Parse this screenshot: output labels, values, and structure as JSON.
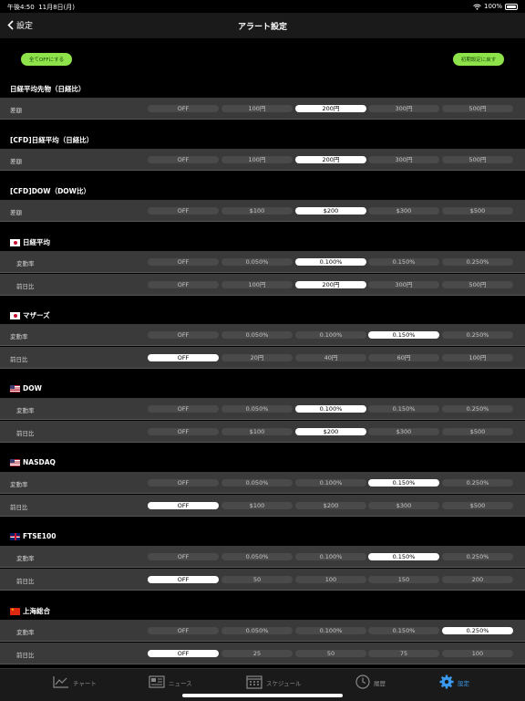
{
  "status": {
    "time": "午後4:50",
    "date": "11月8日(月)",
    "battery": "100%"
  },
  "nav": {
    "back_label": "設定",
    "title": "アラート設定"
  },
  "buttons": {
    "all_off": "全てOFFにする",
    "reset_defaults": "初期設定に戻す"
  },
  "sections": [
    {
      "title": "日経平均先物（日経比）",
      "flag": "none",
      "rows": [
        {
          "label": "差額",
          "options": [
            "OFF",
            "100円",
            "200円",
            "300円",
            "500円"
          ],
          "selected": 2
        }
      ]
    },
    {
      "title": "[CFD]日経平均（日経比）",
      "flag": "none",
      "rows": [
        {
          "label": "差額",
          "options": [
            "OFF",
            "100円",
            "200円",
            "300円",
            "500円"
          ],
          "selected": 2
        }
      ]
    },
    {
      "title": "[CFD]DOW（DOW比）",
      "flag": "none",
      "rows": [
        {
          "label": "差額",
          "options": [
            "OFF",
            "$100",
            "$200",
            "$300",
            "$500"
          ],
          "selected": 2
        }
      ]
    },
    {
      "title": "日経平均",
      "flag": "jp",
      "rows": [
        {
          "label": "変動率",
          "options": [
            "OFF",
            "0.050%",
            "0.100%",
            "0.150%",
            "0.250%"
          ],
          "selected": 2
        },
        {
          "label": "前日比",
          "options": [
            "OFF",
            "100円",
            "200円",
            "300円",
            "500円"
          ],
          "selected": 2
        }
      ]
    },
    {
      "title": "マザーズ",
      "flag": "jp",
      "rows": [
        {
          "label": "変動率",
          "options": [
            "OFF",
            "0.050%",
            "0.100%",
            "0.150%",
            "0.250%"
          ],
          "selected": 3
        },
        {
          "label": "前日比",
          "options": [
            "OFF",
            "20円",
            "40円",
            "60円",
            "100円"
          ],
          "selected": 0
        }
      ]
    },
    {
      "title": "DOW",
      "flag": "us",
      "rows": [
        {
          "label": "変動率",
          "options": [
            "OFF",
            "0.050%",
            "0.100%",
            "0.150%",
            "0.250%"
          ],
          "selected": 2
        },
        {
          "label": "前日比",
          "options": [
            "OFF",
            "$100",
            "$200",
            "$300",
            "$500"
          ],
          "selected": 2
        }
      ]
    },
    {
      "title": "NASDAQ",
      "flag": "us",
      "rows": [
        {
          "label": "変動率",
          "options": [
            "OFF",
            "0.050%",
            "0.100%",
            "0.150%",
            "0.250%"
          ],
          "selected": 3
        },
        {
          "label": "前日比",
          "options": [
            "OFF",
            "$100",
            "$200",
            "$300",
            "$500"
          ],
          "selected": 0
        }
      ]
    },
    {
      "title": "FTSE100",
      "flag": "uk",
      "rows": [
        {
          "label": "変動率",
          "options": [
            "OFF",
            "0.050%",
            "0.100%",
            "0.150%",
            "0.250%"
          ],
          "selected": 3
        },
        {
          "label": "前日比",
          "options": [
            "OFF",
            "50",
            "100",
            "150",
            "200"
          ],
          "selected": 0
        }
      ]
    },
    {
      "title": "上海総合",
      "flag": "cn",
      "rows": [
        {
          "label": "変動率",
          "options": [
            "OFF",
            "0.050%",
            "0.100%",
            "0.150%",
            "0.250%"
          ],
          "selected": 4
        },
        {
          "label": "前日比",
          "options": [
            "OFF",
            "25",
            "50",
            "75",
            "100"
          ],
          "selected": 0
        }
      ]
    }
  ],
  "tabs": [
    {
      "label": "チャート",
      "icon": "chart-icon",
      "active": false
    },
    {
      "label": "ニュース",
      "icon": "news-icon",
      "active": false
    },
    {
      "label": "スケジュール",
      "icon": "calendar-icon",
      "active": false
    },
    {
      "label": "履歴",
      "icon": "clock-icon",
      "active": false
    },
    {
      "label": "設定",
      "icon": "gear-icon",
      "active": true
    }
  ],
  "colors": {
    "accent": "#3b9bf0",
    "button_green": "#8ee24a",
    "row_bg": "#3a3a3a",
    "selected_pill": "#ffffff"
  }
}
